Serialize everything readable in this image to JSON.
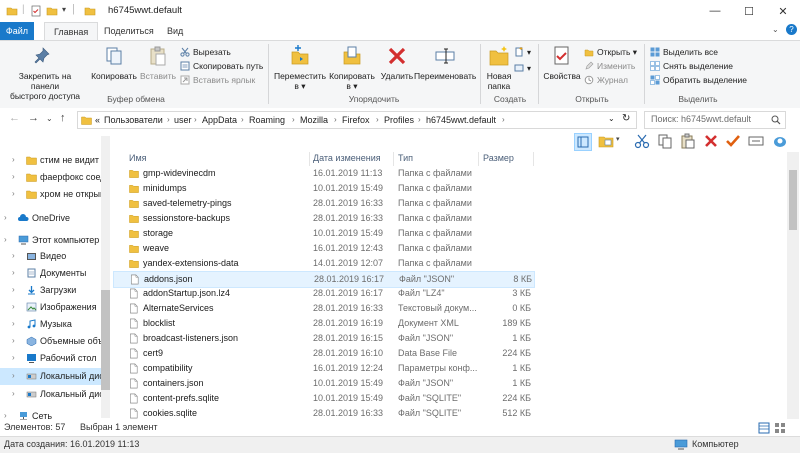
{
  "window": {
    "title": "h6745wwt.default",
    "minimize": "—",
    "maximize": "☐",
    "close": "✕"
  },
  "ribbon_tabs": [
    "Файл",
    "Главная",
    "Поделиться",
    "Вид"
  ],
  "ribbon": {
    "clipboard": {
      "pin": "Закрепить на панели быстрого доступа",
      "pin_l1": "Закрепить на панели",
      "pin_l2": "быстрого доступа",
      "copy": "Копировать",
      "paste": "Вставить",
      "cut": "Вырезать",
      "copy_path": "Скопировать путь",
      "paste_shortcut": "Вставить ярлык",
      "label": "Буфер обмена"
    },
    "organize": {
      "move_l1": "Переместить",
      "move_l2": "в ▾",
      "copy_l1": "Копировать",
      "copy_l2": "в ▾",
      "delete": "Удалить",
      "rename": "Переименовать",
      "label": "Упорядочить"
    },
    "create": {
      "new_folder_l1": "Новая",
      "new_folder_l2": "папка",
      "label": "Создать"
    },
    "open": {
      "properties": "Свойства",
      "open": "Открыть ▾",
      "edit": "Изменить",
      "history": "Журнал",
      "label": "Открыть"
    },
    "select": {
      "select_all": "Выделить все",
      "select_none": "Снять выделение",
      "invert": "Обратить выделение",
      "label": "Выделить"
    }
  },
  "address": {
    "prefix": "«",
    "crumbs": [
      "Пользователи",
      "user",
      "AppData",
      "Roaming",
      "Mozilla",
      "Firefox",
      "Profiles",
      "h6745wwt.default"
    ],
    "search_placeholder": "Поиск: h6745wwt.default"
  },
  "nav_pane": [
    {
      "label": "стим не видит и",
      "icon": "folder"
    },
    {
      "label": "фаерфокс соед",
      "icon": "folder"
    },
    {
      "label": "хром не открыв",
      "icon": "folder"
    },
    {
      "label": "OneDrive",
      "icon": "cloud"
    },
    {
      "label": "Этот компьютер",
      "icon": "computer"
    },
    {
      "label": "Видео",
      "icon": "video"
    },
    {
      "label": "Документы",
      "icon": "documents"
    },
    {
      "label": "Загрузки",
      "icon": "downloads"
    },
    {
      "label": "Изображения",
      "icon": "pictures"
    },
    {
      "label": "Музыка",
      "icon": "music"
    },
    {
      "label": "Объемные объ",
      "icon": "3d"
    },
    {
      "label": "Рабочий стол",
      "icon": "desktop"
    },
    {
      "label": "Локальный дис",
      "icon": "drive",
      "selected": true
    },
    {
      "label": "Локальный дис",
      "icon": "drive"
    },
    {
      "label": "Сеть",
      "icon": "network"
    }
  ],
  "columns": {
    "name": "Имя",
    "date": "Дата изменения",
    "type": "Тип",
    "size": "Размер"
  },
  "files": [
    {
      "name": "gmp-widevinecdm",
      "date": "16.01.2019 11:13",
      "type": "Папка с файлами",
      "size": "",
      "kind": "folder"
    },
    {
      "name": "minidumps",
      "date": "10.01.2019 15:49",
      "type": "Папка с файлами",
      "size": "",
      "kind": "folder"
    },
    {
      "name": "saved-telemetry-pings",
      "date": "28.01.2019 16:33",
      "type": "Папка с файлами",
      "size": "",
      "kind": "folder"
    },
    {
      "name": "sessionstore-backups",
      "date": "28.01.2019 16:33",
      "type": "Папка с файлами",
      "size": "",
      "kind": "folder"
    },
    {
      "name": "storage",
      "date": "10.01.2019 15:49",
      "type": "Папка с файлами",
      "size": "",
      "kind": "folder"
    },
    {
      "name": "weave",
      "date": "16.01.2019 12:43",
      "type": "Папка с файлами",
      "size": "",
      "kind": "folder"
    },
    {
      "name": "yandex-extensions-data",
      "date": "14.01.2019 12:07",
      "type": "Папка с файлами",
      "size": "",
      "kind": "folder"
    },
    {
      "name": "addons.json",
      "date": "28.01.2019 16:17",
      "type": "Файл \"JSON\"",
      "size": "8 КБ",
      "kind": "file",
      "selected": true
    },
    {
      "name": "addonStartup.json.lz4",
      "date": "28.01.2019 16:17",
      "type": "Файл \"LZ4\"",
      "size": "3 КБ",
      "kind": "file"
    },
    {
      "name": "AlternateServices",
      "date": "28.01.2019 16:33",
      "type": "Текстовый докум...",
      "size": "0 КБ",
      "kind": "file"
    },
    {
      "name": "blocklist",
      "date": "28.01.2019 16:19",
      "type": "Документ XML",
      "size": "189 КБ",
      "kind": "file"
    },
    {
      "name": "broadcast-listeners.json",
      "date": "28.01.2019 16:15",
      "type": "Файл \"JSON\"",
      "size": "1 КБ",
      "kind": "file"
    },
    {
      "name": "cert9",
      "date": "28.01.2019 16:10",
      "type": "Data Base File",
      "size": "224 КБ",
      "kind": "file"
    },
    {
      "name": "compatibility",
      "date": "16.01.2019 12:24",
      "type": "Параметры конф...",
      "size": "1 КБ",
      "kind": "file"
    },
    {
      "name": "containers.json",
      "date": "10.01.2019 15:49",
      "type": "Файл \"JSON\"",
      "size": "1 КБ",
      "kind": "file"
    },
    {
      "name": "content-prefs.sqlite",
      "date": "10.01.2019 15:49",
      "type": "Файл \"SQLITE\"",
      "size": "224 КБ",
      "kind": "file"
    },
    {
      "name": "cookies.sqlite",
      "date": "28.01.2019 16:33",
      "type": "Файл \"SQLITE\"",
      "size": "512 КБ",
      "kind": "file"
    }
  ],
  "status": {
    "items_count": "Элементов: 57",
    "item_selected": "Выбран 1 элемент",
    "created": "Дата создания: 16.01.2019 11:13",
    "computer": "Компьютер"
  },
  "colors": {
    "accent": "#1979ca",
    "selection": "#cce8ff",
    "folder": "#f0c040",
    "delete_red": "#d32f2f"
  }
}
